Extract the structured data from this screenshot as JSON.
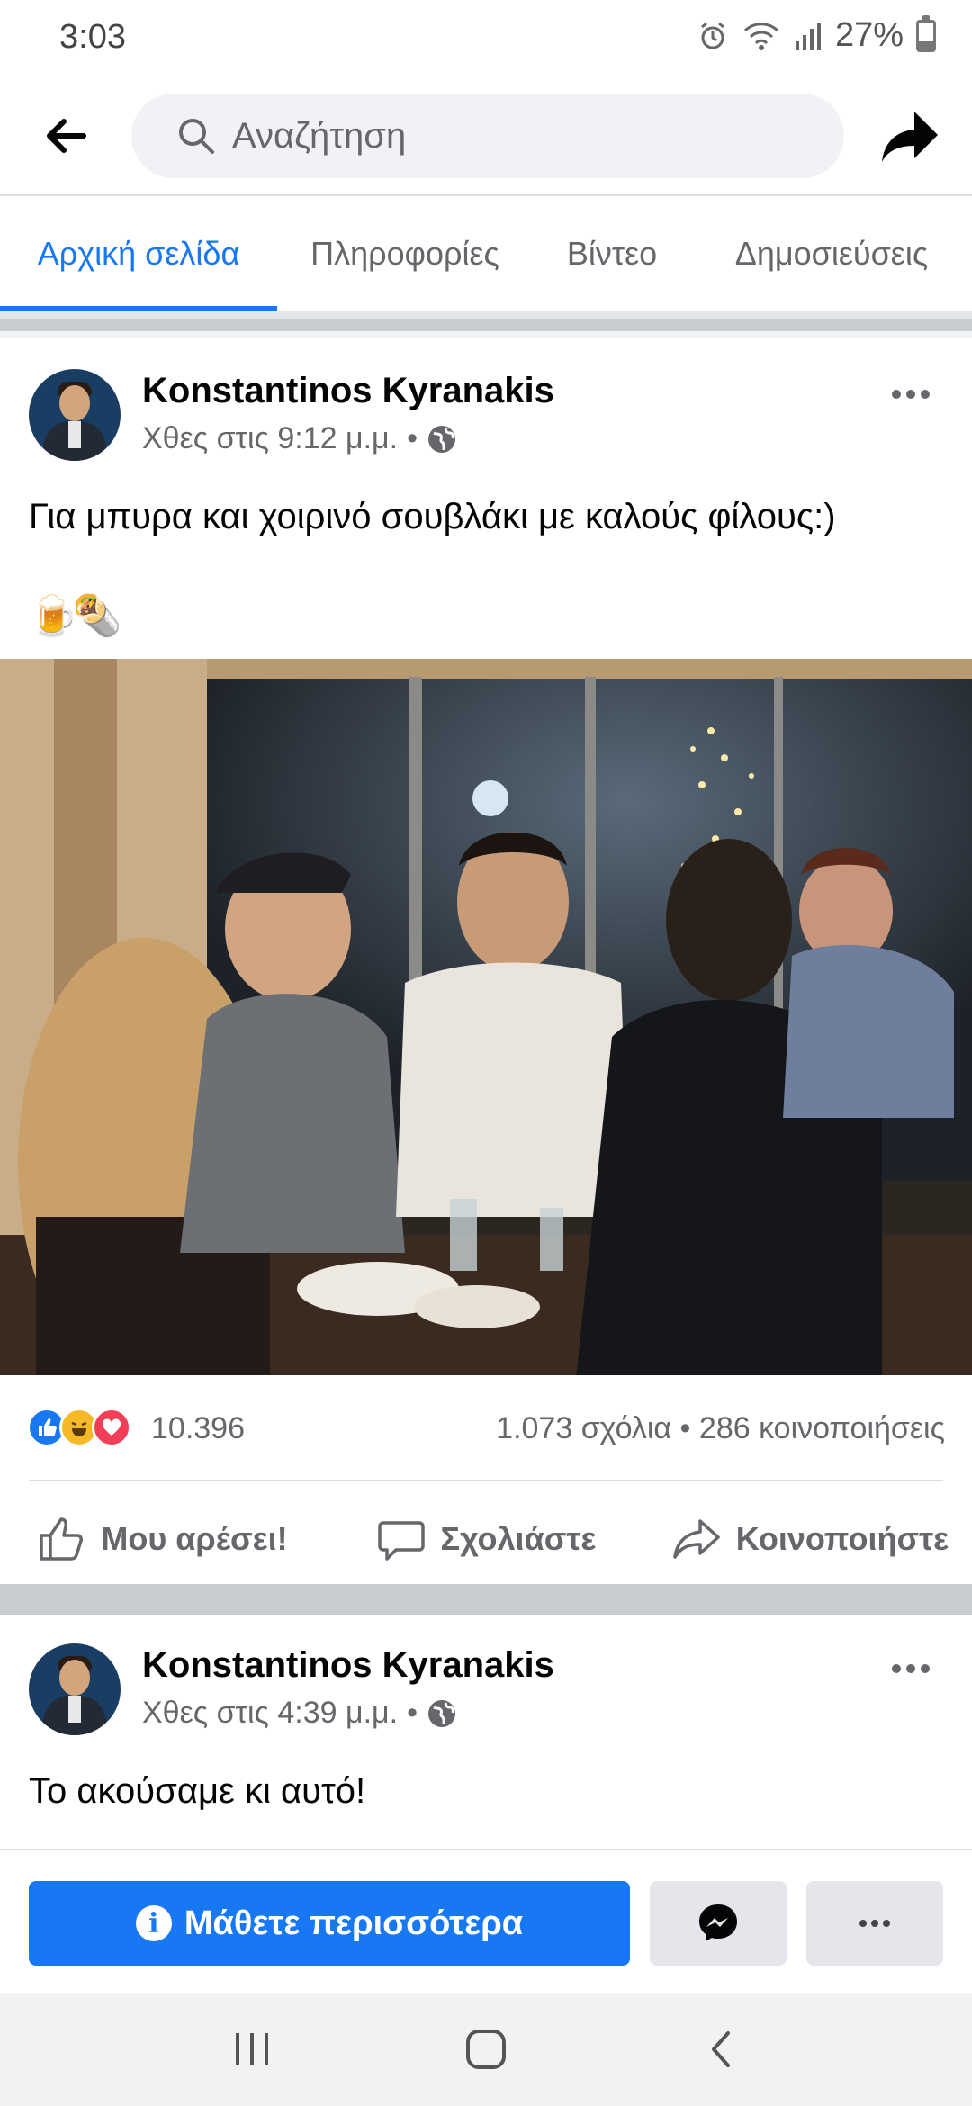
{
  "status_bar": {
    "time": "3:03",
    "battery_percent": "27%",
    "battery_level": 0.27,
    "icons": [
      "alarm-icon",
      "wifi-icon",
      "signal-icon",
      "battery-icon"
    ]
  },
  "header": {
    "search_placeholder": "Αναζήτηση"
  },
  "tabs": [
    {
      "label": "Αρχική σελίδα",
      "active": true
    },
    {
      "label": "Πληροφορίες",
      "active": false
    },
    {
      "label": "Βίντεο",
      "active": false
    },
    {
      "label": "Δημοσιεύσεις",
      "active": false
    }
  ],
  "posts": [
    {
      "author": "Konstantinos Kyranakis",
      "time": "Χθες στις 9:12 μ.μ.",
      "separator": "•",
      "text": "Για μπυρα και χοιρινό σουβλάκι με καλούς φίλους:)",
      "emoji": "🍺🌯",
      "reaction_count": "10.396",
      "comments": "1.073 σχόλια",
      "stats_separator": "•",
      "shares": "286 κοινοποιήσεις",
      "reactions": [
        "like-icon",
        "haha-icon",
        "love-icon"
      ]
    },
    {
      "author": "Konstantinos Kyranakis",
      "time": "Χθες στις 4:39 μ.μ.",
      "separator": "•",
      "text": "Το ακούσαμε κι αυτό!"
    }
  ],
  "actions": {
    "like": "Μου αρέσει!",
    "comment": "Σχολιάστε",
    "share": "Κοινοποιήστε"
  },
  "cta": {
    "learn_more": "Μάθετε περισσότερα",
    "info_glyph": "i"
  },
  "colors": {
    "brand_blue": "#1877f2",
    "like_blue": "#1877f2",
    "haha_yellow": "#f7b928",
    "love_red": "#f33e58"
  }
}
